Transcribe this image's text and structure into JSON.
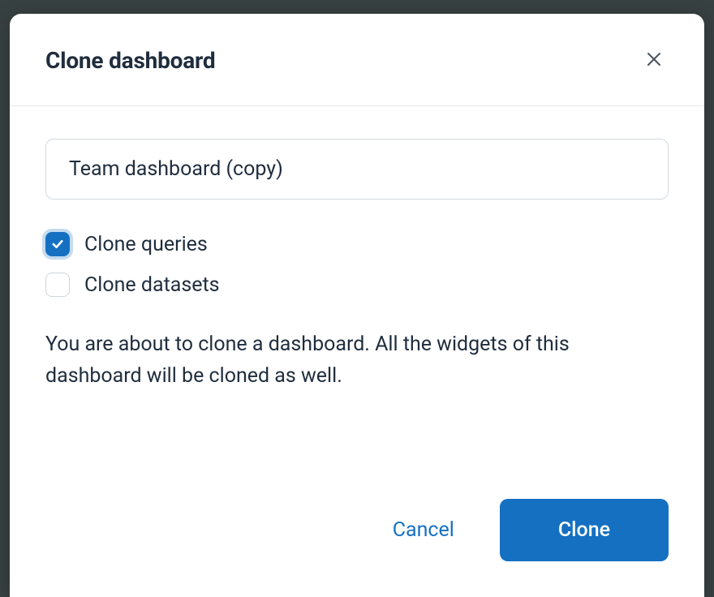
{
  "modal": {
    "title": "Clone dashboard",
    "input": {
      "value": "Team dashboard (copy)"
    },
    "checkboxes": {
      "clone_queries": {
        "label": "Clone queries",
        "checked": true
      },
      "clone_datasets": {
        "label": "Clone datasets",
        "checked": false
      }
    },
    "description": "You are about to clone a dashboard. All the widgets of this dashboard will be cloned as well.",
    "buttons": {
      "cancel": "Cancel",
      "clone": "Clone"
    }
  }
}
